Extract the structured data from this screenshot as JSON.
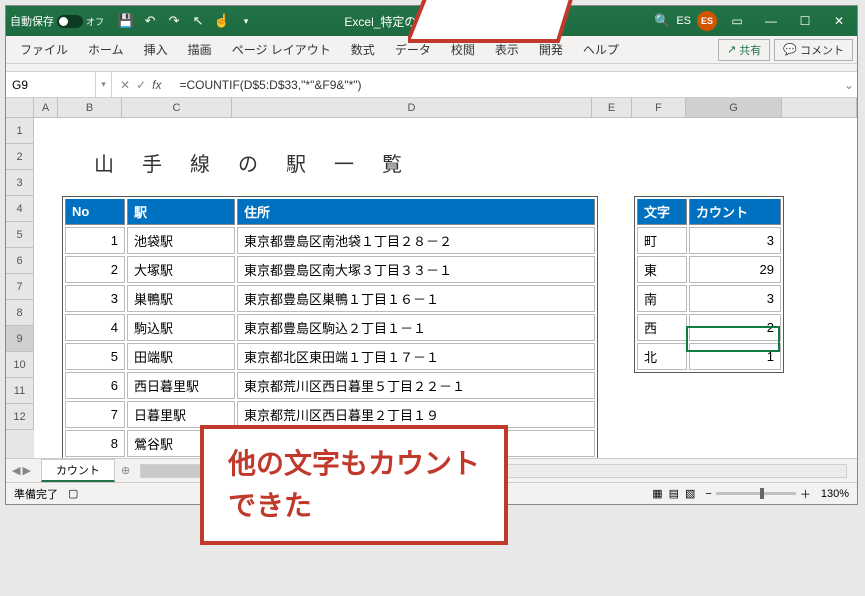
{
  "titlebar": {
    "autosave_label": "自動保存",
    "autosave_state": "オフ",
    "filename": "Excel_特定の文字をカウントする方法.…",
    "user_initials": "ES",
    "avatar_initials": "ES"
  },
  "ribbon": {
    "tabs": [
      "ファイル",
      "ホーム",
      "挿入",
      "描画",
      "ページ レイアウト",
      "数式",
      "データ",
      "校閲",
      "表示",
      "開発",
      "ヘルプ"
    ],
    "share_label": "共有",
    "comment_label": "コメント"
  },
  "formula_bar": {
    "namebox": "G9",
    "formula": "=COUNTIF(D$5:D$33,\"*\"&F9&\"*\")"
  },
  "columns": [
    "A",
    "B",
    "C",
    "D",
    "E",
    "F",
    "G"
  ],
  "row_numbers": [
    "1",
    "2",
    "3",
    "4",
    "5",
    "6",
    "7",
    "8",
    "9",
    "10",
    "11",
    "12"
  ],
  "sheet_title": "山手線の駅一覧",
  "table1": {
    "headers": {
      "no": "No",
      "station": "駅",
      "address": "住所"
    },
    "rows": [
      {
        "no": "1",
        "station": "池袋駅",
        "address": "東京都豊島区南池袋１丁目２８－２"
      },
      {
        "no": "2",
        "station": "大塚駅",
        "address": "東京都豊島区南大塚３丁目３３－１"
      },
      {
        "no": "3",
        "station": "巣鴨駅",
        "address": "東京都豊島区巣鴨１丁目１６－１"
      },
      {
        "no": "4",
        "station": "駒込駅",
        "address": "東京都豊島区駒込２丁目１－１"
      },
      {
        "no": "5",
        "station": "田端駅",
        "address": "東京都北区東田端１丁目１７－１"
      },
      {
        "no": "6",
        "station": "西日暮里駅",
        "address": "東京都荒川区西日暮里５丁目２２－１"
      },
      {
        "no": "7",
        "station": "日暮里駅",
        "address": "東京都荒川区西日暮里２丁目１９"
      },
      {
        "no": "8",
        "station": "鶯谷駅",
        "address": ""
      }
    ]
  },
  "table2": {
    "headers": {
      "char": "文字",
      "count": "カウント"
    },
    "rows": [
      {
        "char": "町",
        "count": "3"
      },
      {
        "char": "東",
        "count": "29"
      },
      {
        "char": "南",
        "count": "3"
      },
      {
        "char": "西",
        "count": "2"
      },
      {
        "char": "北",
        "count": "1"
      }
    ]
  },
  "sheet_tabs": {
    "active": "カウント"
  },
  "statusbar": {
    "ready": "準備完了",
    "zoom": "130%"
  },
  "callout": {
    "line1": "他の文字もカウント",
    "line2": "できた"
  }
}
